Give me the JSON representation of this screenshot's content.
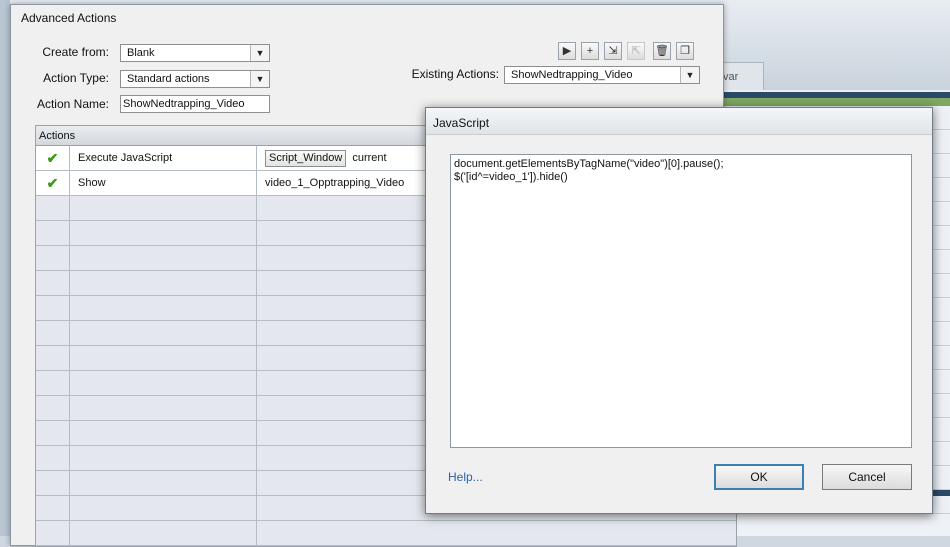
{
  "background_tab_label": "var",
  "advanced_actions": {
    "title": "Advanced Actions",
    "create_from_label": "Create from:",
    "create_from_value": "Blank",
    "action_type_label": "Action Type:",
    "action_type_value": "Standard actions",
    "action_name_label": "Action Name:",
    "action_name_value": "ShowNedtrapping_Video",
    "existing_actions_label": "Existing Actions:",
    "existing_actions_value": "ShowNedtrapping_Video",
    "toolbar_icons": [
      "preview-icon",
      "add-icon",
      "import-icon",
      "export-icon",
      "delete-icon",
      "duplicate-icon"
    ],
    "actions_header": "Actions",
    "rows": [
      {
        "status": "✔",
        "action": "Execute JavaScript",
        "target_button": "Script_Window",
        "target": "current"
      },
      {
        "status": "✔",
        "action": "Show",
        "target_button": "",
        "target": "video_1_Opptrapping_Video"
      }
    ]
  },
  "javascript_dialog": {
    "title": "JavaScript",
    "code": "document.getElementsByTagName(\"video\")[0].pause();\n$('[id^=video_1']).hide()",
    "help_label": "Help...",
    "ok_label": "OK",
    "cancel_label": "Cancel"
  },
  "colors": {
    "check_green": "#3c9a1a",
    "link_blue": "#2a63a8",
    "ok_border": "#3c7fb1"
  }
}
